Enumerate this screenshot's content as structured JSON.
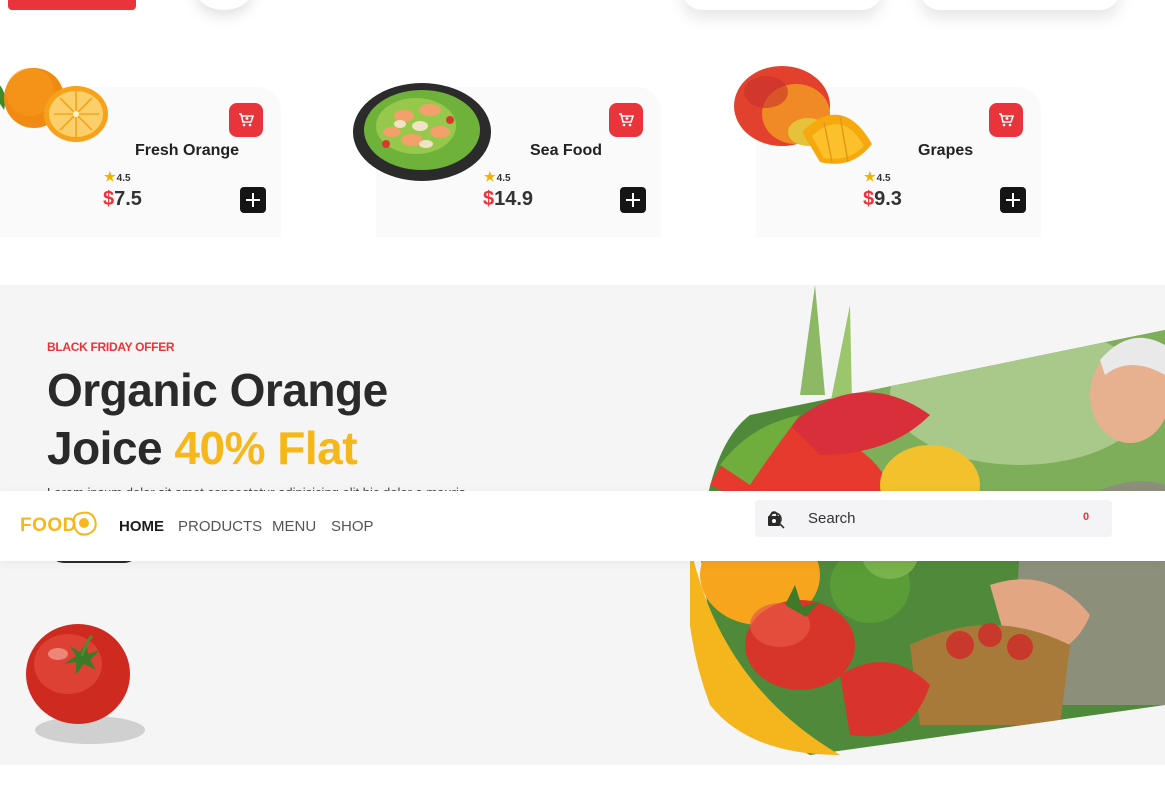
{
  "top_partials": {
    "arrows": [
      "chevron-right-icon",
      "chevron-left-icon",
      "chevron-right-icon",
      "chevron-left-icon"
    ]
  },
  "products": [
    {
      "name": "Fresh Orange",
      "rating": "4.5",
      "currency": "$",
      "price": "7.5",
      "image": "orange"
    },
    {
      "name": "Sea Food",
      "rating": "4.5",
      "currency": "$",
      "price": "14.9",
      "image": "seafood-plate"
    },
    {
      "name": "Grapes",
      "rating": "4.5",
      "currency": "$",
      "price": "9.3",
      "image": "mango"
    }
  ],
  "hero": {
    "tag": "BLACK FRIDAY OFFER",
    "title_line1": "Organic Orange",
    "title_line2": "Joice",
    "title_highlight": "40% Flat",
    "description": "Lorem ipsum dolor sit amet consectetur adipisicing elit hic dolor a mauris",
    "button_label": ""
  },
  "navbar": {
    "logo": "FOOD",
    "items": [
      {
        "label": "HOME",
        "active": true
      },
      {
        "label": "PRODUCTS",
        "active": false
      },
      {
        "label": "MENU",
        "active": false
      },
      {
        "label": "SHOP",
        "active": false
      }
    ],
    "search_placeholder": "Search",
    "cart_count": "0"
  },
  "colors": {
    "accent_red": "#e8343a",
    "accent_yellow": "#f6b71a",
    "dark": "#1c1c1c"
  }
}
